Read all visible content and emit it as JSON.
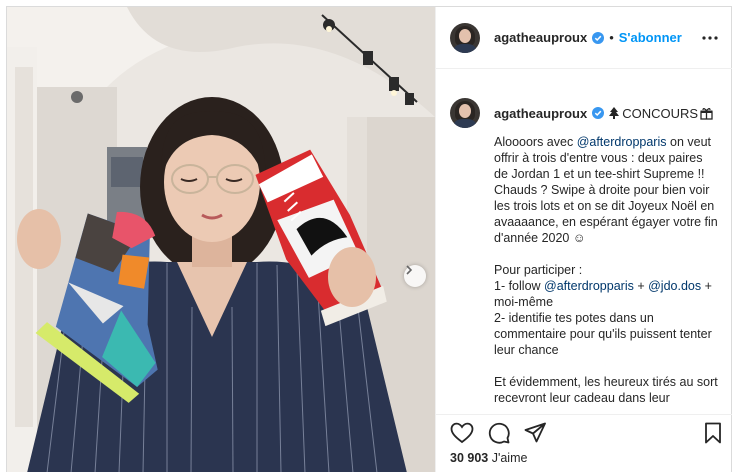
{
  "post": {
    "username": "agatheauproux",
    "follow_label": "S'abonner",
    "separator": "•",
    "caption_title": "CONCOURS",
    "caption_paragraphs": [
      [
        {
          "t": "Aloooors avec "
        },
        {
          "t": "@afterdropparis",
          "m": true
        },
        {
          "t": " on veut offrir à trois d'entre vous : deux paires de Jordan 1 et un tee-shirt Supreme !! Chauds ? Swipe à droite pour bien voir les trois lots et on se dit Joyeux Noël en avaaaance, en espérant égayer votre fin d'année 2020 ☺"
        }
      ],
      [
        {
          "t": "Pour participer :"
        },
        {
          "br": true
        },
        {
          "t": "1- follow "
        },
        {
          "t": "@afterdropparis",
          "m": true
        },
        {
          "t": " + "
        },
        {
          "t": "@jdo.dos",
          "m": true
        },
        {
          "t": " + moi-même"
        },
        {
          "br": true
        },
        {
          "t": "2- identifie tes potes dans un commentaire pour qu'ils puissent tenter leur chance"
        }
      ],
      [
        {
          "t": "Et évidemment, les heureux tirés au sort recevront leur cadeau dans leur"
        }
      ]
    ],
    "likes_count": "30 903",
    "likes_label": "J'aime"
  },
  "icons": {
    "verified": "verified-badge-icon",
    "more": "more-options-icon",
    "tree": "christmas-tree-icon",
    "gift": "gift-icon",
    "next": "chevron-right-icon",
    "like": "heart-icon",
    "comment": "comment-bubble-icon",
    "share": "paper-plane-icon",
    "save": "bookmark-icon"
  },
  "colors": {
    "follow": "#0095f6",
    "mention": "#00376b",
    "verified": "#3897f0"
  }
}
